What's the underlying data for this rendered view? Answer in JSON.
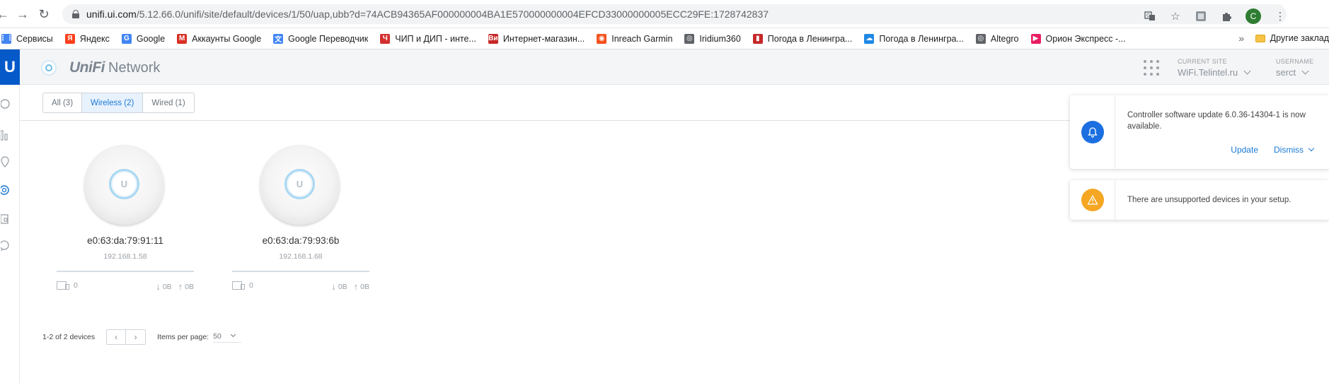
{
  "browser": {
    "url_host": "unifi.ui.com",
    "url_path": "/5.12.66.0/unifi/site/default/devices/1/50/uap,ubb?d=74ACB94365AF000000004BA1E570000000004EFCD33000000005ECC29FE:1728742837",
    "profile_initial": "C",
    "bookmarks": [
      {
        "label": "Сервисы",
        "icon": "apps-grid-icon",
        "color": "#4285f4"
      },
      {
        "label": "Яндекс",
        "icon": "yandex-icon",
        "color": "#fc3f1d"
      },
      {
        "label": "Google",
        "icon": "google-icon",
        "color": "#4285f4"
      },
      {
        "label": "Аккаунты Google",
        "icon": "gmail-icon",
        "color": "#d93025"
      },
      {
        "label": "Google Переводчик",
        "icon": "translate-icon",
        "color": "#4285f4"
      },
      {
        "label": "ЧИП и ДИП - инте...",
        "icon": "chip-dip-icon",
        "color": "#d32f2f"
      },
      {
        "label": "Интернет-магазин...",
        "icon": "vi-icon",
        "color": "#c62828"
      },
      {
        "label": "Inreach Garmin",
        "icon": "inreach-icon",
        "color": "#f4511e"
      },
      {
        "label": "Iridium360",
        "icon": "globe-icon",
        "color": "#5f6368"
      },
      {
        "label": "Погода в Ленингра...",
        "icon": "thermometer-icon",
        "color": "#c62828"
      },
      {
        "label": "Погода в Ленингра...",
        "icon": "weather-icon",
        "color": "#1e88e5"
      },
      {
        "label": "Altegro",
        "icon": "globe-icon",
        "color": "#5f6368"
      },
      {
        "label": "Орион Экспресс -...",
        "icon": "orion-icon",
        "color": "#e91e63"
      }
    ],
    "more_label": "»",
    "other_bookmarks": "Другие заклад"
  },
  "app": {
    "brand_unifi": "UniFi",
    "brand_network": "Network",
    "current_site_label": "CURRENT SITE",
    "current_site_value": "WiFi.Telintel.ru",
    "username_label": "USERNAME",
    "username_value": "serct"
  },
  "filters": [
    {
      "label": "All (3)",
      "active": false
    },
    {
      "label": "Wireless (2)",
      "active": true
    },
    {
      "label": "Wired (1)",
      "active": false
    }
  ],
  "devices": [
    {
      "name": "e0:63:da:79:91:11",
      "ip": "192.168.1.58",
      "clients": "0",
      "down": "0B",
      "up": "0B"
    },
    {
      "name": "e0:63:da:79:93:6b",
      "ip": "192.168.1.68",
      "clients": "0",
      "down": "0B",
      "up": "0B"
    }
  ],
  "pagination": {
    "range": "1-2 of 2 devices",
    "items_per_page_label": "Items per page:",
    "items_per_page_value": "50"
  },
  "notifications": [
    {
      "text": "Controller software update 6.0.36-14304-1 is now available.",
      "icon": "bell-icon",
      "color": "#1b6fe0",
      "update_label": "Update",
      "dismiss_label": "Dismiss"
    },
    {
      "text": "There are unsupported devices in your setup.",
      "icon": "warning-icon",
      "color": "#f5a623"
    }
  ]
}
